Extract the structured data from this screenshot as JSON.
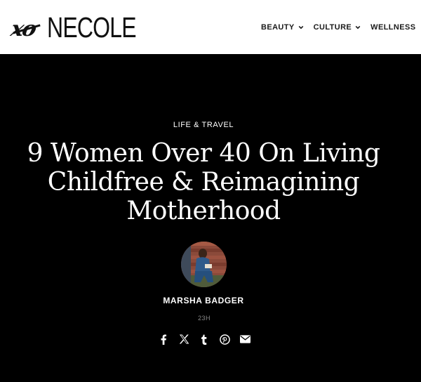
{
  "header": {
    "logo_script": "xo",
    "logo_word": "NECOLE",
    "nav": [
      {
        "label": "BEAUTY"
      },
      {
        "label": "CULTURE"
      },
      {
        "label": "WELLNESS"
      }
    ]
  },
  "article": {
    "category": "LIFE & TRAVEL",
    "title": "9 Women Over 40 On Living Childfree & Reimagining Motherhood",
    "author": "MARSHA BADGER",
    "timestamp": "23H",
    "share_icons": [
      "facebook-icon",
      "x-icon",
      "tumblr-icon",
      "pinterest-icon",
      "email-icon"
    ]
  },
  "colors": {
    "hero_bg": "#000000",
    "text_light": "#ffffff",
    "timestamp": "#8a8a8a"
  }
}
